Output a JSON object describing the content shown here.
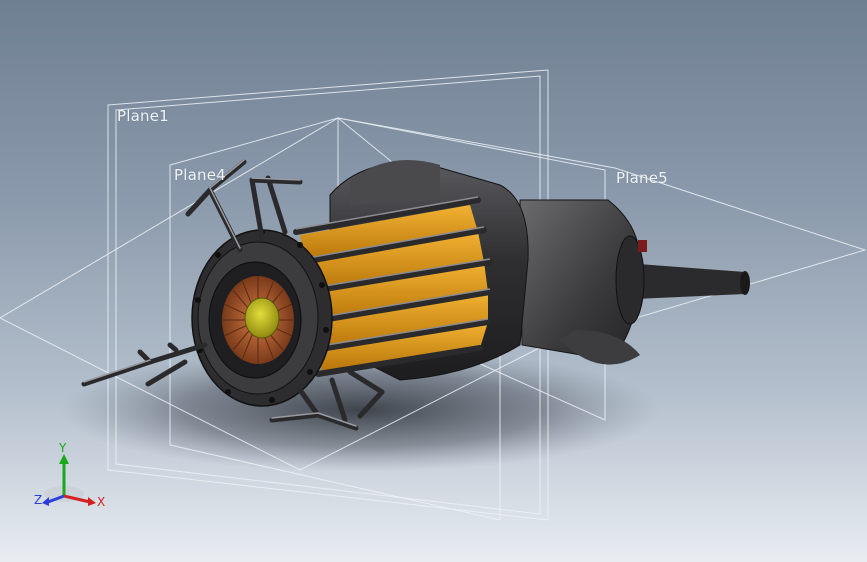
{
  "planes": [
    {
      "name": "Plane1"
    },
    {
      "name": "Plane4"
    },
    {
      "name": "Plane5"
    }
  ],
  "triad": {
    "x_label": "X",
    "y_label": "Y",
    "z_label": "Z",
    "x_color": "#d62020",
    "y_color": "#18a818",
    "z_color": "#2c3fd8"
  },
  "colors": {
    "background_top": "#6f7f92",
    "background_bottom": "#e9edf2",
    "body": "#3b3b3d",
    "fins": "#e39a14",
    "core": "#c9c41e",
    "coil": "#a0522d"
  }
}
